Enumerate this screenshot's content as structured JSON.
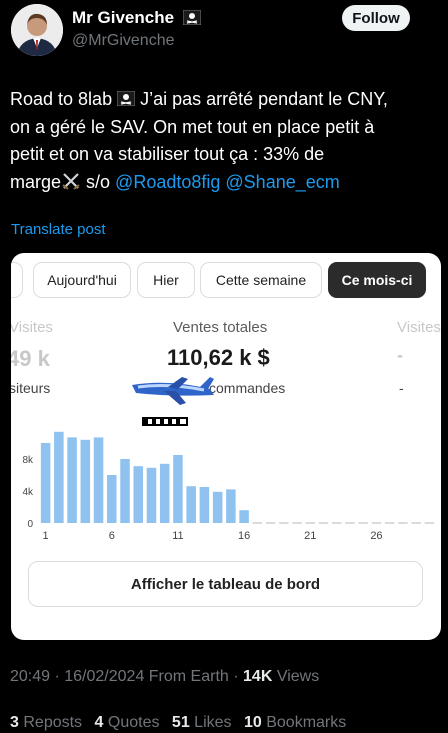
{
  "author": {
    "name": "Mr Givenche",
    "handle": "@MrGivenche",
    "follow_label": "Follow"
  },
  "post": {
    "line1_text": "Road to 8lab",
    "line1_rest": " J’ai pas arrêté pendant le CNY,",
    "line2": "on a géré le SAV. On met tout en place petit à",
    "line3": "petit et on va stabiliser tout ça : 33% de",
    "line4_start": "marge",
    "line4_so": " s/o ",
    "mention1": "@Roadto8fig",
    "mention2": "@Shane_ecm",
    "translate_label": "Translate post"
  },
  "card": {
    "tabs": [
      {
        "label": ""
      },
      {
        "label": "Aujourd'hui"
      },
      {
        "label": "Hier"
      },
      {
        "label": "Cette semaine"
      },
      {
        "label": "Ce mois-ci"
      }
    ],
    "metric_left": {
      "label": "Visites",
      "value": "49 k",
      "sub": "siteurs"
    },
    "metric_main": {
      "label": "Ventes totales",
      "value": "110,62 k $",
      "sub": "commandes"
    },
    "metric_right": {
      "label": "Visites",
      "value": "-",
      "sub": "-"
    },
    "dashboard_button": "Afficher le tableau de bord"
  },
  "chart_data": {
    "type": "bar",
    "x": [
      1,
      2,
      3,
      4,
      5,
      6,
      7,
      8,
      9,
      10,
      11,
      12,
      13,
      14,
      15,
      16,
      17,
      18,
      19,
      20,
      21,
      22,
      23,
      24,
      25,
      26,
      27,
      28,
      29,
      30
    ],
    "values": [
      10000,
      11400,
      10700,
      10400,
      10700,
      6000,
      8000,
      7100,
      6900,
      7400,
      8500,
      4600,
      4500,
      3900,
      4200,
      1600,
      0,
      0,
      0,
      0,
      0,
      0,
      0,
      0,
      0,
      0,
      0,
      0,
      0,
      0
    ],
    "y_ticks": [
      "0",
      "4k",
      "8k"
    ],
    "x_ticks": [
      "1",
      "6",
      "11",
      "16",
      "21",
      "26"
    ],
    "ylim": [
      0,
      12000
    ],
    "bar_color": "#90c2f0"
  },
  "meta": {
    "time": "20:49 · 16/02/2024 From Earth · ",
    "views_count": "14K",
    "views_label": " Views"
  },
  "stats": [
    {
      "count": "3",
      "label": "Reposts"
    },
    {
      "count": "4",
      "label": "Quotes"
    },
    {
      "count": "51",
      "label": "Likes"
    },
    {
      "count": "10",
      "label": "Bookmarks"
    }
  ]
}
